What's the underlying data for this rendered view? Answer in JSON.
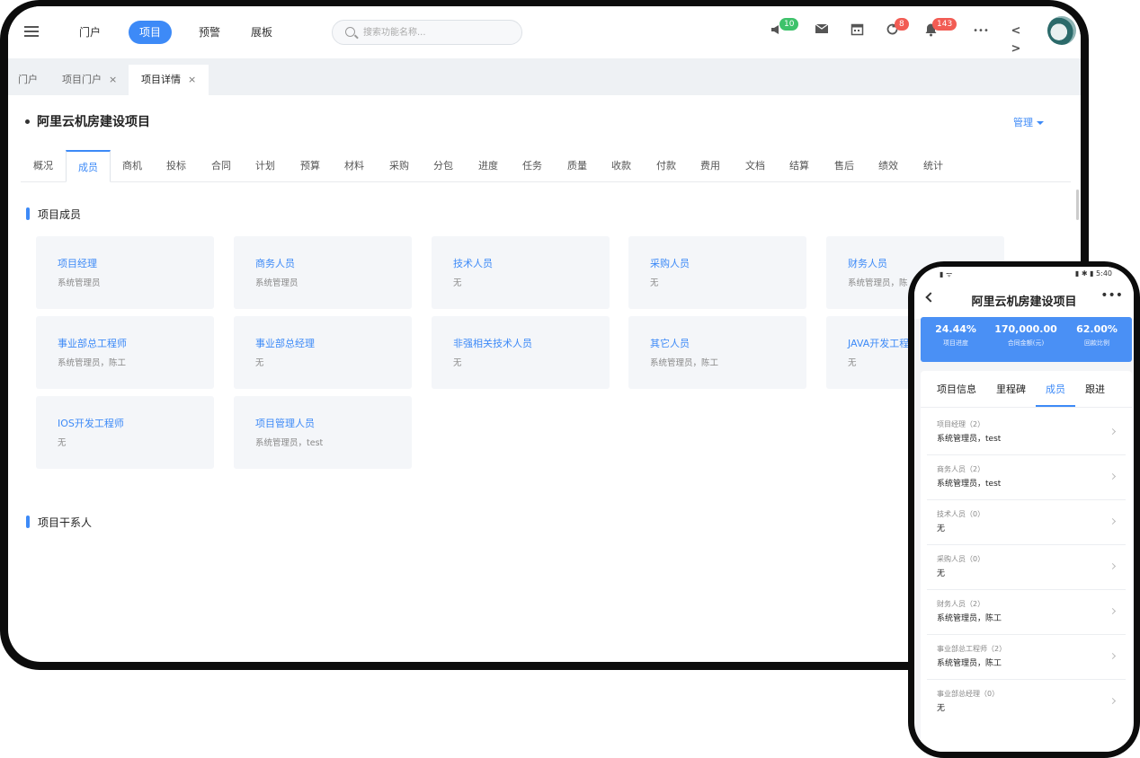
{
  "topnav": {
    "items": [
      "门户",
      "项目",
      "预警",
      "展板"
    ],
    "active_index": 1,
    "search_placeholder": "搜索功能名称...",
    "badges": {
      "announce": "10",
      "sync": "8",
      "notify": "143"
    },
    "code_label": "< >",
    "more_label": "•••"
  },
  "tabs": [
    {
      "label": "门户"
    },
    {
      "label": "项目门户",
      "close": "×"
    },
    {
      "label": "项目详情",
      "close": "×"
    }
  ],
  "page": {
    "title": "阿里云机房建设项目",
    "manage_label": "管理",
    "subtabs": [
      "概况",
      "成员",
      "商机",
      "投标",
      "合同",
      "计划",
      "预算",
      "材料",
      "采购",
      "分包",
      "进度",
      "任务",
      "质量",
      "收款",
      "付款",
      "费用",
      "文档",
      "结算",
      "售后",
      "绩效",
      "统计"
    ],
    "active_subtab": 1,
    "members_section": "项目成员",
    "stakeholders_section": "项目干系人",
    "member_cards": [
      {
        "title": "项目经理",
        "value": "系统管理员"
      },
      {
        "title": "商务人员",
        "value": "系统管理员"
      },
      {
        "title": "技术人员",
        "value": "无"
      },
      {
        "title": "采购人员",
        "value": "无"
      },
      {
        "title": "财务人员",
        "value": "系统管理员，陈"
      },
      {
        "title": "事业部总工程师",
        "value": "系统管理员，陈工"
      },
      {
        "title": "事业部总经理",
        "value": "无"
      },
      {
        "title": "非强相关技术人员",
        "value": "无"
      },
      {
        "title": "其它人员",
        "value": "系统管理员，陈工"
      },
      {
        "title": "JAVA开发工程",
        "value": "无"
      },
      {
        "title": "IOS开发工程师",
        "value": "无"
      },
      {
        "title": "项目管理人员",
        "value": "系统管理员，test"
      }
    ]
  },
  "phone": {
    "status_left": "▮ ᯤ",
    "status_right": "▮ ✱ ▮ 5:40",
    "title": "阿里云机房建设项目",
    "more": "•••",
    "stats": [
      {
        "value": "24.44%",
        "label": "项目进度"
      },
      {
        "value": "170,000.00",
        "label": "合同金额(元)"
      },
      {
        "value": "62.00%",
        "label": "回款比例"
      }
    ],
    "tabs": [
      "项目信息",
      "里程碑",
      "成员",
      "跟进"
    ],
    "active_tab": 2,
    "rows": [
      {
        "label": "项目经理（2）",
        "value": "系统管理员，test"
      },
      {
        "label": "商务人员（2）",
        "value": "系统管理员，test"
      },
      {
        "label": "技术人员（0）",
        "value": "无"
      },
      {
        "label": "采购人员（0）",
        "value": "无"
      },
      {
        "label": "财务人员（2）",
        "value": "系统管理员，陈工"
      },
      {
        "label": "事业部总工程师（2）",
        "value": "系统管理员，陈工"
      },
      {
        "label": "事业部总经理（0）",
        "value": "无"
      }
    ]
  },
  "colors": {
    "accent": "#3d8af7",
    "badge_green": "#3ec26b",
    "badge_red": "#f25c54",
    "card_bg": "#f4f6f9"
  }
}
